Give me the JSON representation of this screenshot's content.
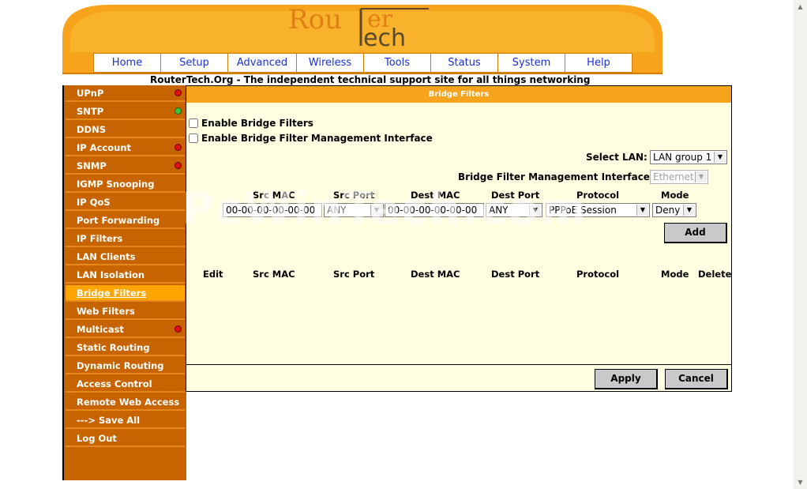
{
  "logo": {
    "text_top": "Rou",
    "text_mid": "ter",
    "text_bottom": "Tech"
  },
  "nav": [
    "Home",
    "Setup",
    "Advanced",
    "Wireless",
    "Tools",
    "Status",
    "System",
    "Help"
  ],
  "tagline": "RouterTech.Org - The independent technical support site for all things networking",
  "sidebar": [
    {
      "label": "UPnP",
      "status": "red"
    },
    {
      "label": "SNTP",
      "status": "green"
    },
    {
      "label": "DDNS"
    },
    {
      "label": "IP Account",
      "status": "red"
    },
    {
      "label": "SNMP",
      "status": "red"
    },
    {
      "label": "IGMP Snooping"
    },
    {
      "label": "IP QoS"
    },
    {
      "label": "Port Forwarding"
    },
    {
      "label": "IP Filters"
    },
    {
      "label": "LAN Clients"
    },
    {
      "label": "LAN Isolation"
    },
    {
      "label": "Bridge Filters",
      "active": true
    },
    {
      "label": "Web Filters"
    },
    {
      "label": "Multicast",
      "status": "red"
    },
    {
      "label": "Static Routing"
    },
    {
      "label": "Dynamic Routing"
    },
    {
      "label": "Access Control"
    },
    {
      "label": "Remote Web Access"
    },
    {
      "label": "---> Save All"
    },
    {
      "label": "Log Out"
    }
  ],
  "panel": {
    "title": "Bridge Filters",
    "enable_filters_label": "Enable Bridge Filters",
    "enable_mgmt_label": "Enable Bridge Filter Management Interface",
    "select_lan_label": "Select LAN:",
    "select_lan_value": "LAN group 1",
    "mgmt_iface_label": "Bridge Filter Management Interface:",
    "mgmt_iface_value": "Ethernet",
    "form_headers": {
      "src_mac": "Src MAC",
      "src_port": "Src Port",
      "dest_mac": "Dest MAC",
      "dest_port": "Dest Port",
      "protocol": "Protocol",
      "mode": "Mode"
    },
    "form_values": {
      "src_mac": "00-00-00-00-00-00",
      "src_port": "ANY",
      "dest_mac": "00-00-00-00-00-00",
      "dest_port": "ANY",
      "protocol": "PPPoE Session",
      "mode": "Deny"
    },
    "add_label": "Add",
    "table_headers": [
      "Edit",
      "Src MAC",
      "Src Port",
      "Dest MAC",
      "Dest Port",
      "Protocol",
      "Mode",
      "Delete"
    ],
    "apply_label": "Apply",
    "cancel_label": "Cancel"
  },
  "watermark": "PcWinTech.com",
  "colors": {
    "orange": "#f7a31c",
    "sidebar": "#c86400",
    "panel_bg": "#fffee1",
    "link_blue": "#1a2fd0"
  }
}
